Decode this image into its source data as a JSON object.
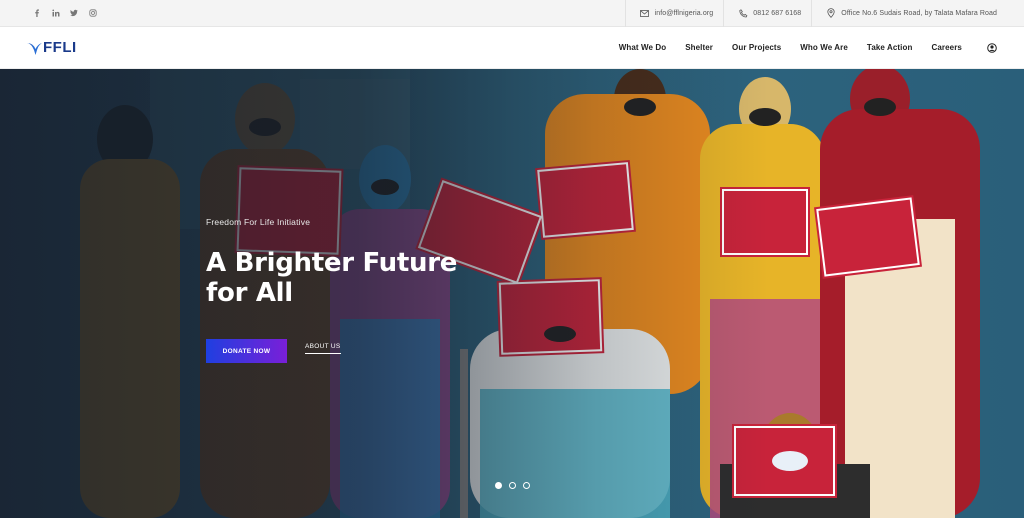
{
  "topbar": {
    "socials": [
      {
        "icon": "facebook-icon",
        "glyph": "f"
      },
      {
        "icon": "linkedin-icon",
        "glyph": "in"
      },
      {
        "icon": "twitter-icon",
        "glyph": "t"
      },
      {
        "icon": "instagram-icon",
        "glyph": "◎"
      }
    ],
    "email": "info@fflnigeria.org",
    "phone": "0812 687 6168",
    "address": "Office No.6 Sudais Road, by Talata Mafara Road"
  },
  "nav": {
    "logo_text": "FFLI",
    "items": [
      "What We Do",
      "Shelter",
      "Our Projects",
      "Who We Are",
      "Take Action",
      "Careers"
    ]
  },
  "hero": {
    "eyebrow": "Freedom For Life Initiative",
    "headline_line1": "A Brighter Future",
    "headline_line2": "for All",
    "donate_label": "DONATE NOW",
    "about_label": "ABOUT US",
    "slides_count": 3,
    "active_slide": 1
  },
  "colors": {
    "brand_blue": "#1a3a8a",
    "button_gradient_start": "#1f3fe0",
    "button_gradient_end": "#7a1fd8",
    "sign_red": "#c8233a"
  }
}
